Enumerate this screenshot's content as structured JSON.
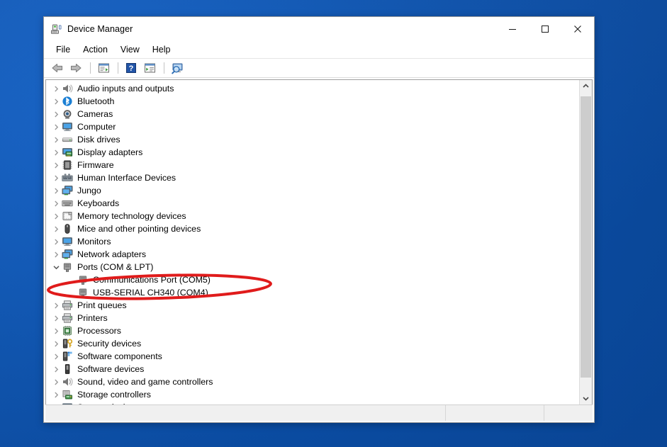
{
  "window": {
    "title": "Device Manager",
    "title_icon": "device-manager-icon",
    "controls": {
      "minimize": "Minimize",
      "maximize": "Maximize",
      "close": "Close"
    }
  },
  "menubar": {
    "items": [
      {
        "label": "File",
        "name": "menu-file"
      },
      {
        "label": "Action",
        "name": "menu-action"
      },
      {
        "label": "View",
        "name": "menu-view"
      },
      {
        "label": "Help",
        "name": "menu-help"
      }
    ]
  },
  "toolbar": {
    "buttons": [
      {
        "name": "back-button",
        "icon": "back-arrow-icon"
      },
      {
        "name": "forward-button",
        "icon": "forward-arrow-icon"
      },
      {
        "name": "properties-button",
        "icon": "properties-icon"
      },
      {
        "name": "help-button",
        "icon": "help-question-icon"
      },
      {
        "name": "update-driver-button",
        "icon": "update-driver-icon"
      },
      {
        "name": "scan-hardware-button",
        "icon": "scan-for-hardware-icon"
      }
    ]
  },
  "tree": {
    "items": [
      {
        "label": "Audio inputs and outputs",
        "icon": "speaker-icon",
        "state": "collapsed",
        "depth": 0
      },
      {
        "label": "Bluetooth",
        "icon": "bluetooth-icon",
        "state": "collapsed",
        "depth": 0
      },
      {
        "label": "Cameras",
        "icon": "camera-icon",
        "state": "collapsed",
        "depth": 0
      },
      {
        "label": "Computer",
        "icon": "computer-icon",
        "state": "collapsed",
        "depth": 0
      },
      {
        "label": "Disk drives",
        "icon": "disk-drive-icon",
        "state": "collapsed",
        "depth": 0
      },
      {
        "label": "Display adapters",
        "icon": "display-adapter-icon",
        "state": "collapsed",
        "depth": 0
      },
      {
        "label": "Firmware",
        "icon": "firmware-chip-icon",
        "state": "collapsed",
        "depth": 0
      },
      {
        "label": "Human Interface Devices",
        "icon": "hid-icon",
        "state": "collapsed",
        "depth": 0
      },
      {
        "label": "Jungo",
        "icon": "network-device-icon",
        "state": "collapsed",
        "depth": 0
      },
      {
        "label": "Keyboards",
        "icon": "keyboard-icon",
        "state": "collapsed",
        "depth": 0
      },
      {
        "label": "Memory technology devices",
        "icon": "memory-device-icon",
        "state": "collapsed",
        "depth": 0
      },
      {
        "label": "Mice and other pointing devices",
        "icon": "mouse-icon",
        "state": "collapsed",
        "depth": 0
      },
      {
        "label": "Monitors",
        "icon": "monitor-icon",
        "state": "collapsed",
        "depth": 0
      },
      {
        "label": "Network adapters",
        "icon": "network-device-icon",
        "state": "collapsed",
        "depth": 0
      },
      {
        "label": "Ports (COM & LPT)",
        "icon": "port-icon",
        "state": "expanded",
        "depth": 0
      },
      {
        "label": "Communications Port (COM5)",
        "icon": "port-icon",
        "state": "leaf",
        "depth": 1
      },
      {
        "label": "USB-SERIAL CH340 (COM4)",
        "icon": "port-icon",
        "state": "leaf",
        "depth": 1
      },
      {
        "label": "Print queues",
        "icon": "printer-icon",
        "state": "collapsed",
        "depth": 0
      },
      {
        "label": "Printers",
        "icon": "printer-icon",
        "state": "collapsed",
        "depth": 0
      },
      {
        "label": "Processors",
        "icon": "processor-icon",
        "state": "collapsed",
        "depth": 0
      },
      {
        "label": "Security devices",
        "icon": "security-key-icon",
        "state": "collapsed",
        "depth": 0
      },
      {
        "label": "Software components",
        "icon": "software-component-icon",
        "state": "collapsed",
        "depth": 0
      },
      {
        "label": "Software devices",
        "icon": "software-device-icon",
        "state": "collapsed",
        "depth": 0
      },
      {
        "label": "Sound, video and game controllers",
        "icon": "speaker-icon",
        "state": "collapsed",
        "depth": 0
      },
      {
        "label": "Storage controllers",
        "icon": "storage-controller-icon",
        "state": "collapsed",
        "depth": 0
      },
      {
        "label": "System devices",
        "icon": "system-device-icon",
        "state": "collapsed",
        "depth": 0
      }
    ]
  },
  "scrollbar": {
    "up_arrow": "scroll-up-icon",
    "down_arrow": "scroll-down-icon",
    "thumb_top_pct": 5,
    "thumb_height_pct": 88
  },
  "statusbar": {
    "pane1": "",
    "pane2": "",
    "pane3": ""
  },
  "annotation": {
    "type": "ellipse-highlight",
    "target_label": "USB-SERIAL CH340 (COM4)",
    "color": "#e01b1b",
    "stroke_width": 4
  },
  "colors": {
    "desktop": "#0c55b4",
    "window_bg": "#ffffff",
    "annotation_red": "#e01b1b",
    "chevron_gray": "#8a8a8a"
  }
}
